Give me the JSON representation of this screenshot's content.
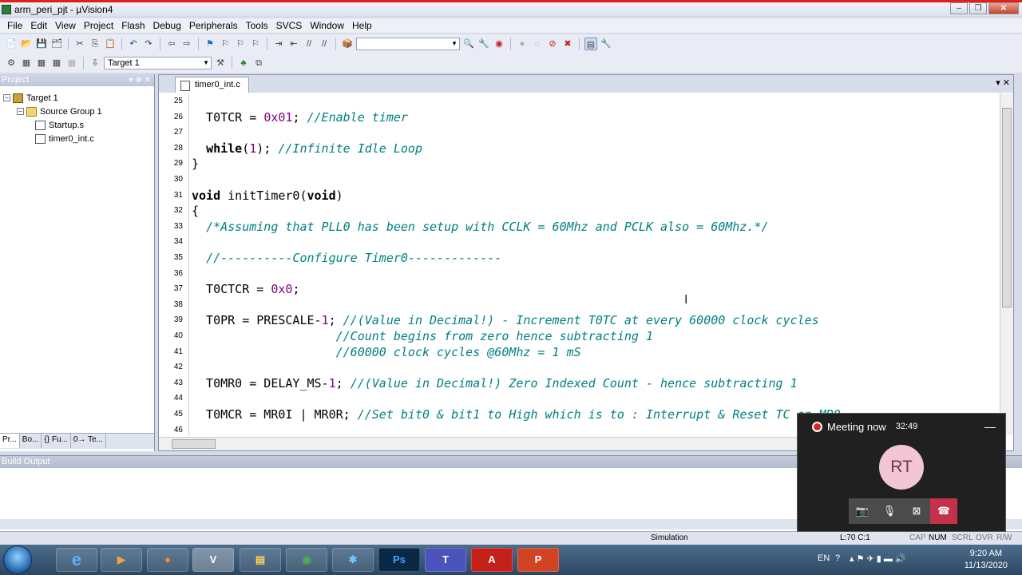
{
  "window": {
    "title": "arm_peri_pjt - µVision4",
    "minimize": "–",
    "restore": "❐",
    "close": "✕"
  },
  "menu": [
    "File",
    "Edit",
    "View",
    "Project",
    "Flash",
    "Debug",
    "Peripherals",
    "Tools",
    "SVCS",
    "Window",
    "Help"
  ],
  "toolbar2": {
    "target_combo": "Target 1"
  },
  "project_panel": {
    "title": "Project",
    "tree": [
      {
        "label": "Target 1",
        "level": 0,
        "kind": "target",
        "expander": "−"
      },
      {
        "label": "Source Group 1",
        "level": 1,
        "kind": "folder",
        "expander": "−"
      },
      {
        "label": "Startup.s",
        "level": 2,
        "kind": "file"
      },
      {
        "label": "timer0_int.c",
        "level": 2,
        "kind": "file"
      }
    ],
    "tabs": [
      "Pr...",
      "Bo...",
      "{} Fu...",
      "0→ Te..."
    ]
  },
  "editor": {
    "tab_label": "timer0_int.c",
    "lines": [
      {
        "n": "25",
        "t": ""
      },
      {
        "n": "26",
        "t": "  T0TCR = 0x01; //Enable timer"
      },
      {
        "n": "27",
        "t": ""
      },
      {
        "n": "28",
        "t": "  while(1); //Infinite Idle Loop"
      },
      {
        "n": "29",
        "t": "}"
      },
      {
        "n": "30",
        "t": ""
      },
      {
        "n": "31",
        "t": "void initTimer0(void)"
      },
      {
        "n": "32",
        "t": "{"
      },
      {
        "n": "33",
        "t": "  /*Assuming that PLL0 has been setup with CCLK = 60Mhz and PCLK also = 60Mhz.*/"
      },
      {
        "n": "34",
        "t": ""
      },
      {
        "n": "35",
        "t": "  //----------Configure Timer0-------------"
      },
      {
        "n": "36",
        "t": ""
      },
      {
        "n": "37",
        "t": "  T0CTCR = 0x0;"
      },
      {
        "n": "38",
        "t": ""
      },
      {
        "n": "39",
        "t": "  T0PR = PRESCALE-1; //(Value in Decimal!) - Increment T0TC at every 60000 clock cycles"
      },
      {
        "n": "40",
        "t": "                    //Count begins from zero hence subtracting 1"
      },
      {
        "n": "41",
        "t": "                    //60000 clock cycles @60Mhz = 1 mS"
      },
      {
        "n": "42",
        "t": ""
      },
      {
        "n": "43",
        "t": "  T0MR0 = DELAY_MS-1; //(Value in Decimal!) Zero Indexed Count - hence subtracting 1"
      },
      {
        "n": "44",
        "t": ""
      },
      {
        "n": "45",
        "t": "  T0MCR = MR0I | MR0R; //Set bit0 & bit1 to High which is to : Interrupt & Reset TC on MR0"
      },
      {
        "n": "46",
        "t": ""
      }
    ]
  },
  "build_output": {
    "title": "Build Output"
  },
  "statusbar": {
    "mode": "Simulation",
    "position": "L:70 C:1",
    "cap": "CAP",
    "num": "NUM",
    "scrl": "SCRL",
    "ovr": "OVR",
    "rw": "R/W"
  },
  "meeting": {
    "status": "Meeting now",
    "time": "32:49",
    "initials": "RT",
    "minimize": "—"
  },
  "taskbar": {
    "lang": "EN",
    "time": "9:20 AM",
    "date": "11/13/2020"
  }
}
